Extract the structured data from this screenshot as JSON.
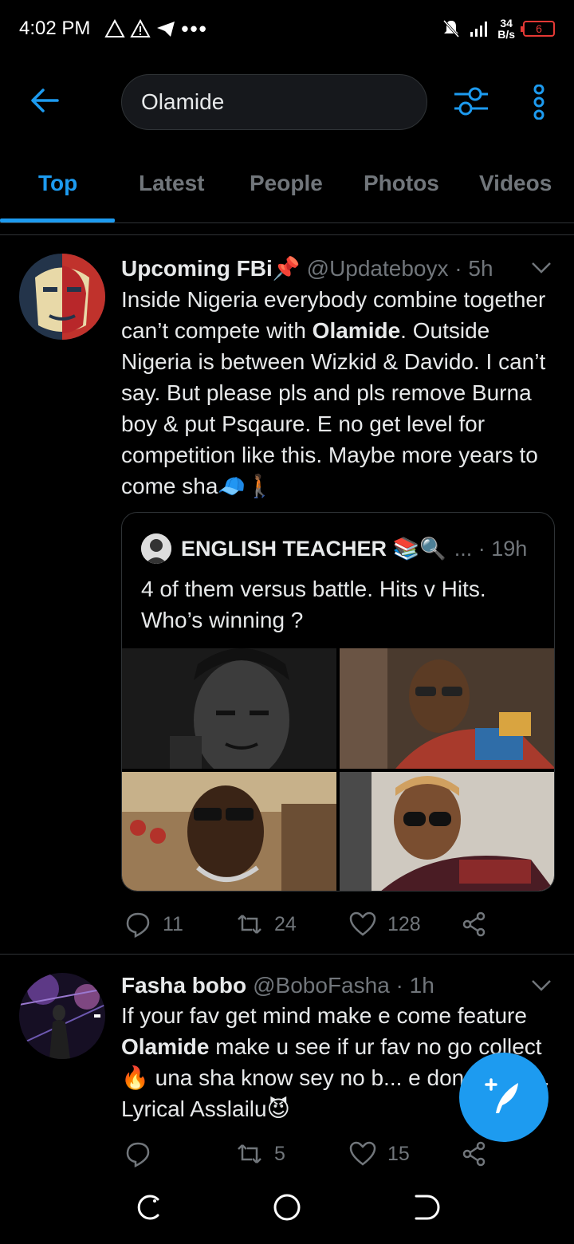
{
  "status_bar": {
    "time": "4:02 PM",
    "left_icons": [
      "warning-icon",
      "warning-icon",
      "telegram-icon",
      "more-dots-icon"
    ],
    "speed_value": "34",
    "speed_unit": "B/s",
    "battery": "6"
  },
  "header": {
    "search_value": "Olamide"
  },
  "tabs": [
    {
      "label": "Top",
      "active": true
    },
    {
      "label": "Latest",
      "active": false
    },
    {
      "label": "People",
      "active": false
    },
    {
      "label": "Photos",
      "active": false
    },
    {
      "label": "Videos",
      "active": false
    }
  ],
  "tweets": [
    {
      "name": "Upcoming FBi📌",
      "handle": "@Updateboyx · 5h",
      "text_before": "Inside Nigeria everybody combine together can’t compete with ",
      "text_bold": "Olamide",
      "text_after": ". Outside Nigeria is between Wizkid & Davido. I can’t say. But please pls and pls remove Burna boy & put Psqaure. E no get level for competition like this. Maybe more years to come sha🧢🚶🏾",
      "quote": {
        "name": "ENGLISH TEACHER 📚🔍",
        "meta": "... · 19h",
        "text": "4 of them versus battle. Hits v Hits. Who’s winning ?"
      },
      "replies": "11",
      "retweets": "24",
      "likes": "128"
    },
    {
      "name": "Fasha bobo",
      "handle": "@BoboFasha · 1h",
      "text_before": "If your fav get mind make e come feature ",
      "text_bold": "Olamide",
      "text_after": " make u see if ur fav no go collect🔥 una sha know sey no b... e don tey gan. Lyrical Asslailu😈",
      "replies": "",
      "retweets": "5",
      "likes": "15"
    }
  ],
  "colors": {
    "accent": "#1d9bf0",
    "background": "#000000",
    "muted": "#71767b",
    "battery_low": "#e53935"
  }
}
